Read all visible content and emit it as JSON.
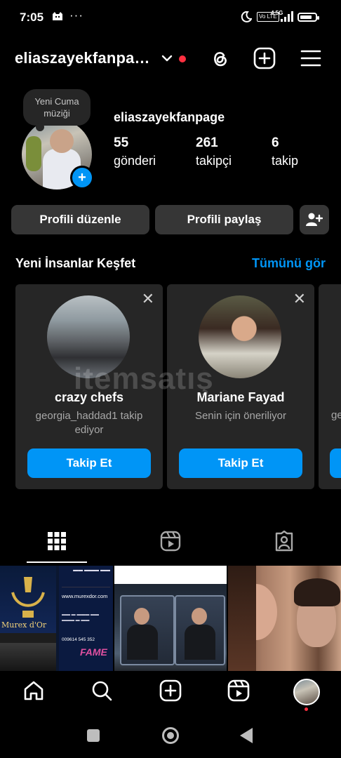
{
  "status_bar": {
    "time": "7:05",
    "more": "···",
    "volte": "Vo LTE",
    "network": "4.5G"
  },
  "header": {
    "username": "eliaszayekfanpa…",
    "icons": [
      "chevron-down-icon",
      "threads-icon",
      "create-plus-icon",
      "menu-icon"
    ]
  },
  "profile": {
    "note": "Yeni Cuma müziği",
    "name": "eliaszayekfanpage",
    "stats": [
      {
        "value": "55",
        "label": "gönderi"
      },
      {
        "value": "261",
        "label": "takipçi"
      },
      {
        "value": "6",
        "label": "takip"
      }
    ],
    "edit_button": "Profili düzenle",
    "share_button": "Profili paylaş"
  },
  "discover": {
    "title": "Yeni İnsanlar Keşfet",
    "see_all": "Tümünü gör",
    "cards": [
      {
        "name": "crazy chefs",
        "subtitle": "georgia_haddad1 takip ediyor",
        "button": "Takip Et"
      },
      {
        "name": "Mariane Fayad",
        "subtitle": "Senin için öneriliyor",
        "button": "Takip Et"
      }
    ],
    "partial_card_text": "geo"
  },
  "watermark": "itemsatış",
  "tabs": [
    "grid-icon",
    "reels-icon",
    "tagged-icon"
  ],
  "grid": {
    "post1": {
      "brand": "Murex d'Or",
      "site": "www.murexdor.com",
      "phone": "009614 545 352",
      "logo": "FAME"
    },
    "post2": {},
    "post3": {}
  },
  "bottom_nav": [
    "home-icon",
    "search-icon",
    "create-icon",
    "reels-icon",
    "profile-avatar"
  ],
  "colors": {
    "accent": "#0095f6",
    "card_bg": "#262626",
    "button_bg": "#363636",
    "notify_red": "#ff3040"
  }
}
